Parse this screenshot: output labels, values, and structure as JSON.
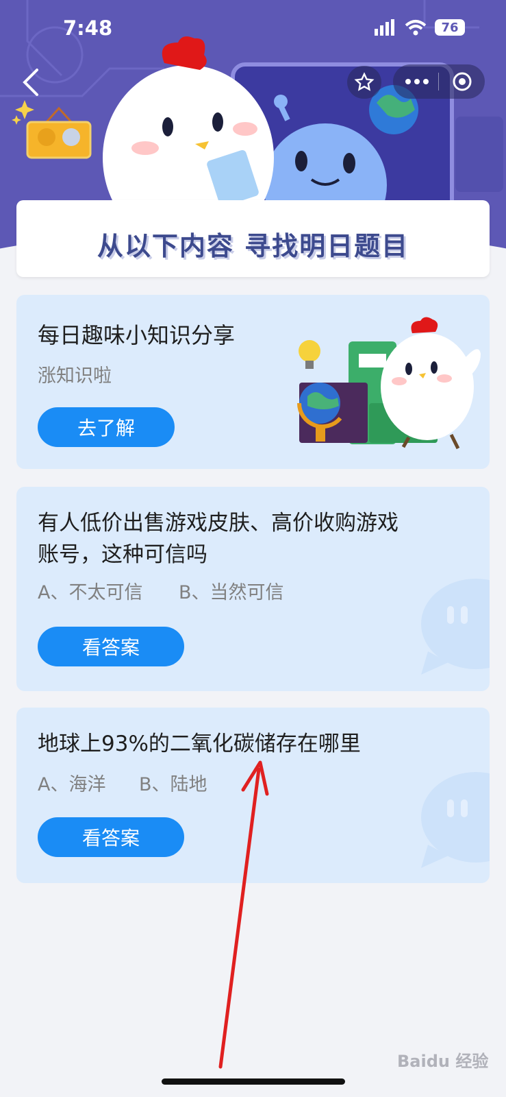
{
  "status_bar": {
    "time": "7:48",
    "battery": "76"
  },
  "header": {
    "banner_title": "从以下内容 寻找明日题目"
  },
  "cards": [
    {
      "title": "每日趣味小知识分享",
      "subtitle": "涨知识啦",
      "button": "去了解"
    },
    {
      "title_line1": "有人低价出售游戏皮肤、高价收购游戏",
      "title_line2": "账号，这种可信吗",
      "option_a": "A、不太可信",
      "option_b": "B、当然可信",
      "button": "看答案"
    },
    {
      "title": "地球上93%的二氧化碳储存在哪里",
      "option_a": "A、海洋",
      "option_b": "B、陆地",
      "button": "看答案"
    }
  ],
  "watermark": "Baidu 经验",
  "colors": {
    "header": "#5d58b5",
    "card": "#dcebfc",
    "button": "#1a8cf5",
    "arrow": "#e02020"
  }
}
